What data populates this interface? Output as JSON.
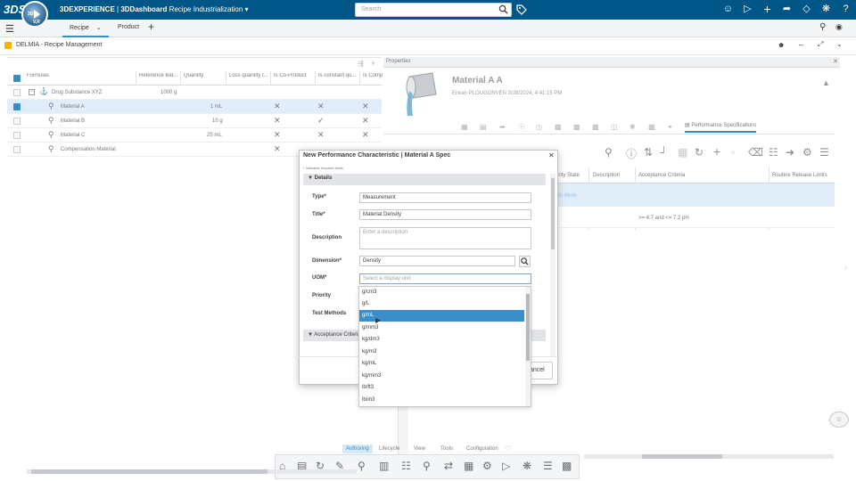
{
  "topbar": {
    "brand_logo": "3DS",
    "compass_top": "3D",
    "compass_bottom": "V,R",
    "title_brand": "3DEXPERIENCE",
    "title_sep": " | ",
    "title_app": "3DDashboard",
    "title_dashboard": "Recipe Industrialization",
    "search_placeholder": "Search",
    "icons": [
      "user-icon",
      "tag-icon",
      "plus-icon",
      "share-icon",
      "network-icon",
      "tools-icon",
      "help-icon"
    ]
  },
  "tabs": {
    "recipe_label": "Recipe",
    "product_label": "Product"
  },
  "widget": {
    "title": "DELMIA - Recipe Management"
  },
  "table": {
    "columns": [
      "Formulas",
      "Reference Bat...",
      "Quantity",
      "Loss quantity r...",
      "Is Co-Product",
      "Is constant qu...",
      "Is Comp"
    ],
    "rows": [
      {
        "name": "Drug Substance XYZ",
        "ref": "1000 g",
        "qty": "",
        "checked": false,
        "selected": false,
        "coproduct": "",
        "constant": "",
        "comp": ""
      },
      {
        "name": "Material A",
        "ref": "",
        "qty": "1 mL",
        "checked": true,
        "selected": true,
        "coproduct": "✕",
        "constant": "✕",
        "comp": "✕"
      },
      {
        "name": "Material B",
        "ref": "",
        "qty": "10 g",
        "checked": false,
        "selected": false,
        "coproduct": "✕",
        "constant": "✓",
        "comp": "✕"
      },
      {
        "name": "Material C",
        "ref": "",
        "qty": "25 mL",
        "checked": false,
        "selected": false,
        "coproduct": "✕",
        "constant": "✕",
        "comp": "✕"
      },
      {
        "name": "Compensation Material",
        "ref": "",
        "qty": "",
        "checked": false,
        "selected": false,
        "coproduct": "✕",
        "constant": "",
        "comp": "✕"
      }
    ]
  },
  "properties": {
    "panel_label": "Properties",
    "material_title": "Material A",
    "material_rev": "A",
    "subtitle": "Erwan PLOUGONVEN  3/28/2024, 4:41:15 PM",
    "perf_tab": "Performance Specifications",
    "grid_columns": [
      "urity State",
      "Description",
      "Acceptance Criteria",
      "Routine Release Limits"
    ],
    "row1_state": "In Work",
    "row2_criteria": ">= 4.7 and <= 7.2   pH"
  },
  "dialog": {
    "title": "New Performance Characteristic | Material A Spec",
    "required_note": "* Indicates required fields",
    "section_details": "Details",
    "section_accept": "Acceptance Criteria",
    "fields": {
      "type_label": "Type*",
      "type_value": "Measurement",
      "title_label": "Title*",
      "title_value": "Material Density",
      "desc_label": "Description",
      "desc_placeholder": "Enter a description",
      "dimension_label": "Dimension*",
      "dimension_value": "Density",
      "uom_label": "UOM*",
      "uom_placeholder": "Select a display unit",
      "priority_label": "Priority",
      "test_methods_label": "Test Methods"
    },
    "cancel_label": "ancel"
  },
  "dropdown": {
    "options": [
      "g/cm3",
      "g/L",
      "g/mL",
      "g/mm3",
      "kg/dm3",
      "kg/m3",
      "kg/mL",
      "kg/mm3",
      "lb/ft3",
      "lb/in3"
    ],
    "highlighted": "g/mL"
  },
  "actionbar": {
    "tabs": [
      "Authoring",
      "Lifecycle",
      "View",
      "Tools",
      "Configuration"
    ],
    "active_tab": "Authoring"
  }
}
